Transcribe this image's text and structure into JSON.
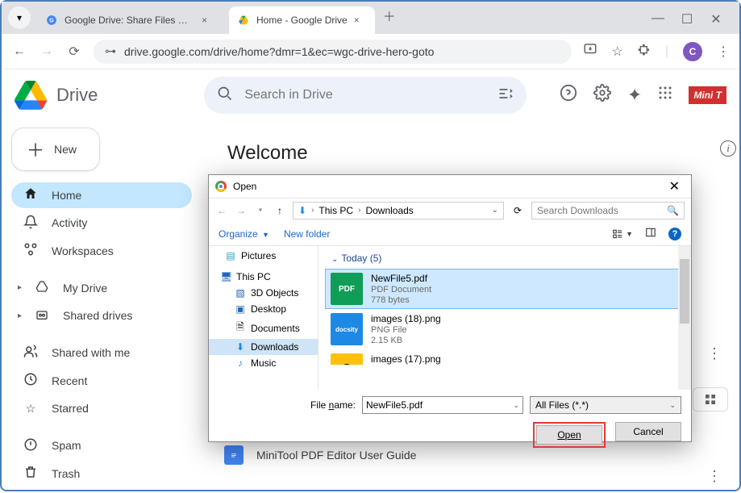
{
  "tabs": {
    "tab1": {
      "label": "Google Drive: Share Files Onlin"
    },
    "tab2": {
      "label": "Home - Google Drive"
    }
  },
  "url": "drive.google.com/drive/home?dmr=1&ec=wgc-drive-hero-goto",
  "avatar_letter": "C",
  "drive_name": "Drive",
  "search_placeholder": "Search in Drive",
  "new_button": "New",
  "sidebar": {
    "home": "Home",
    "activity": "Activity",
    "workspaces": "Workspaces",
    "mydrive": "My Drive",
    "shared_drives": "Shared drives",
    "shared_with_me": "Shared with me",
    "recent": "Recent",
    "starred": "Starred",
    "spam": "Spam",
    "trash": "Trash"
  },
  "welcome": "Welcome",
  "doc_item": "MiniTool PDF Editor User Guide",
  "mini_badge": "Mini T",
  "dialog": {
    "title": "Open",
    "bc_thispc": "This PC",
    "bc_downloads": "Downloads",
    "search_placeholder": "Search Downloads",
    "organize": "Organize",
    "new_folder": "New folder",
    "tree": {
      "pictures": "Pictures",
      "thispc": "This PC",
      "objects3d": "3D Objects",
      "desktop": "Desktop",
      "documents": "Documents",
      "downloads": "Downloads",
      "music": "Music"
    },
    "group_today": "Today (5)",
    "files": [
      {
        "name": "NewFile5.pdf",
        "type": "PDF Document",
        "size": "778 bytes",
        "badge": "PDF"
      },
      {
        "name": "images (18).png",
        "type": "PNG File",
        "size": "2.15 KB",
        "badge": "docsity"
      },
      {
        "name": "images (17).png",
        "type": "",
        "size": "",
        "badge": "S"
      }
    ],
    "filename_label_pre": "File ",
    "filename_label_u": "n",
    "filename_label_post": "ame:",
    "filename_value": "NewFile5.pdf",
    "filter": "All Files (*.*)",
    "open_btn_u": "O",
    "open_btn_rest": "pen",
    "cancel_btn": "Cancel"
  }
}
